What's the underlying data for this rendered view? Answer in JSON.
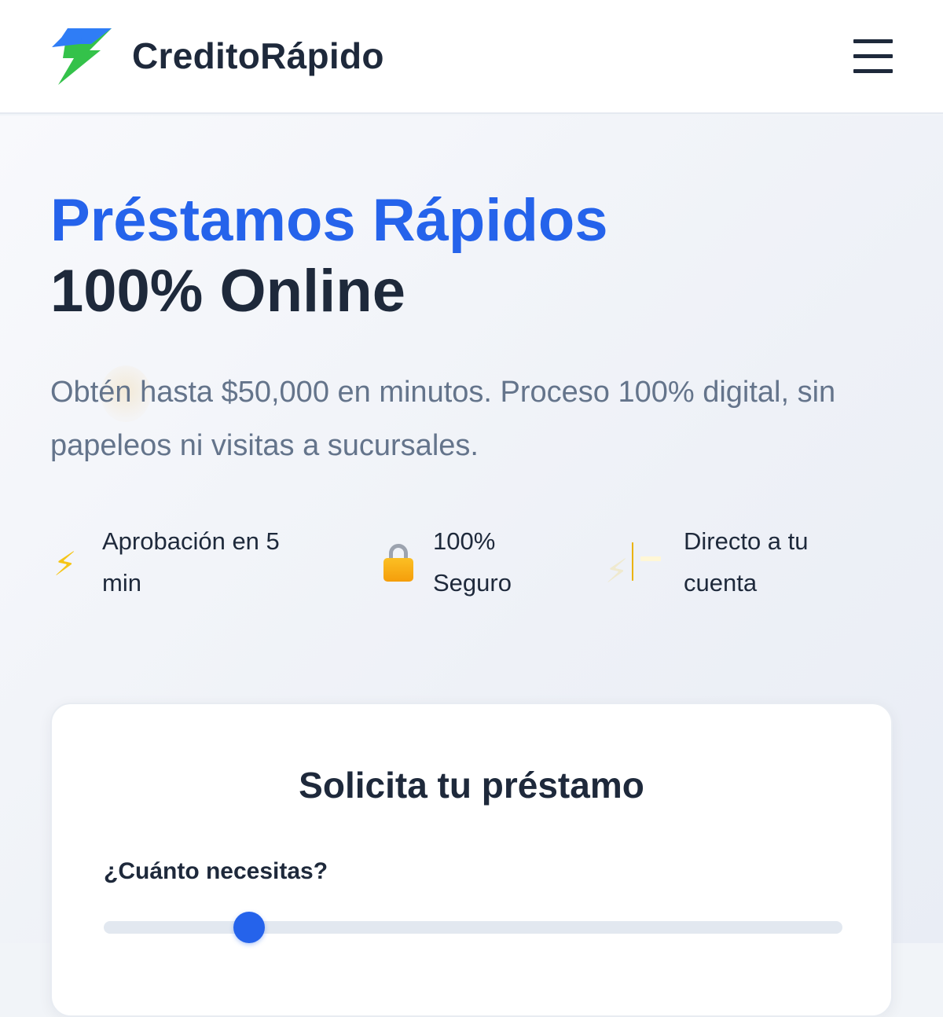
{
  "header": {
    "brand": "CreditoRápido",
    "logo_icon": "lightning-bolt-icon",
    "menu_icon": "hamburger-menu-icon"
  },
  "hero": {
    "title_line1": "Préstamos Rápidos",
    "title_line2": "100% Online",
    "subtitle": "Obtén hasta $50,000 en minutos. Proceso 100% digital, sin papeleos ni visitas a sucursales."
  },
  "features": [
    {
      "icon": "lightning-icon",
      "glyph": "⚡",
      "label": "Aprobación en 5 min"
    },
    {
      "icon": "lock-icon",
      "label": "100% Seguro"
    },
    {
      "icon": "credit-card-icon",
      "label": "Directo a tu cuenta"
    }
  ],
  "loan_form": {
    "title": "Solicita tu préstamo",
    "amount_label": "¿Cuánto necesitas?",
    "slider_fraction": 0.197
  },
  "colors": {
    "primary": "#2563eb",
    "text_dark": "#1e293b",
    "text_muted": "#64748b",
    "logo_blue": "#2f7df6",
    "logo_green": "#34c24a"
  }
}
